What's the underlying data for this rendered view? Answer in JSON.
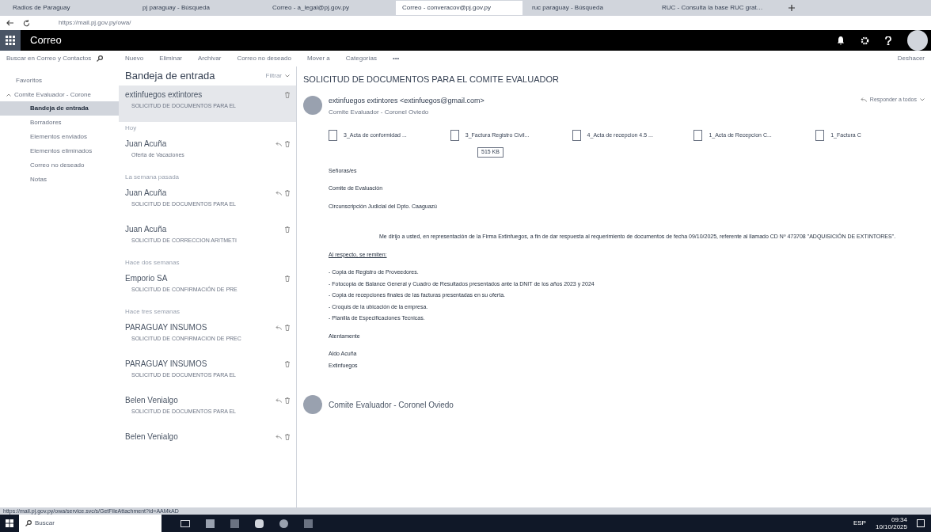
{
  "browser": {
    "tabs": [
      {
        "label": "Radios de Paraguay",
        "selected": false
      },
      {
        "label": "pj paraguay - Búsqueda",
        "selected": false
      },
      {
        "label": "Correo - a_legal@pj.gov.py",
        "selected": false
      },
      {
        "label": "Correo - converacov@pj.gov.py",
        "selected": true
      },
      {
        "label": "ruc paraguay - Búsqueda",
        "selected": false
      },
      {
        "label": "RUC - Consulta la base RUC grat…",
        "selected": false
      }
    ],
    "address": "https://mail.pj.gov.py/owa/"
  },
  "app": {
    "title": "Correo"
  },
  "toolbar": {
    "search_placeholder": "Buscar en Correo y Contactos",
    "actions": [
      "Nuevo",
      "Eliminar",
      "Archivar",
      "Correo no deseado",
      "Mover a",
      "Categorías",
      "•••"
    ],
    "undo": "Deshacer"
  },
  "folders": {
    "favorites": "Favoritos",
    "account": {
      "label": "Comite Evaluador - Corone",
      "expanded": true,
      "children": [
        {
          "label": "Bandeja de entrada",
          "selected": true
        },
        {
          "label": "Borradores",
          "selected": false
        },
        {
          "label": "Elementos enviados",
          "selected": false
        },
        {
          "label": "Elementos eliminados",
          "selected": false
        },
        {
          "label": "Correo no deseado",
          "selected": false
        },
        {
          "label": "Notas",
          "selected": false
        }
      ]
    }
  },
  "message_list": {
    "title": "Bandeja de entrada",
    "filter": "Filtrar",
    "items": [
      {
        "kind": "message",
        "sender": "extinfuegos extintores",
        "subject": "SOLICITUD DE DOCUMENTOS PARA EL",
        "selected": true,
        "replied": false
      },
      {
        "kind": "header",
        "label": "Hoy"
      },
      {
        "kind": "message",
        "sender": "Juan Acuña",
        "subject": "Oferta de Vacaciones",
        "selected": false,
        "replied": true
      },
      {
        "kind": "header",
        "label": "La semana pasada"
      },
      {
        "kind": "message",
        "sender": "Juan Acuña",
        "subject": "SOLICITUD DE DOCUMENTOS PARA EL",
        "selected": false,
        "replied": true
      },
      {
        "kind": "message",
        "sender": "Juan Acuña",
        "subject": "SOLICITUD DE CORRECCION ARITMETI",
        "selected": false,
        "replied": false
      },
      {
        "kind": "header",
        "label": "Hace dos semanas"
      },
      {
        "kind": "message",
        "sender": "Emporio SA",
        "subject": "SOLICITUD DE CONFIRMACIÓN DE PRE",
        "selected": false,
        "replied": false
      },
      {
        "kind": "header",
        "label": "Hace tres semanas"
      },
      {
        "kind": "message",
        "sender": "PARAGUAY INSUMOS",
        "subject": "SOLICITUD DE CONFIRMACION DE PREC",
        "selected": false,
        "replied": true
      },
      {
        "kind": "message",
        "sender": "PARAGUAY INSUMOS",
        "subject": "SOLICITUD DE DOCUMENTOS PARA EL",
        "selected": false,
        "replied": false
      },
      {
        "kind": "message",
        "sender": "Belen Venialgo",
        "subject": "SOLICITUD DE DOCUMENTOS PARA EL",
        "selected": false,
        "replied": true
      },
      {
        "kind": "message",
        "sender": "Belen Venialgo",
        "selected": false,
        "replied": true
      }
    ]
  },
  "reading_pane": {
    "subject": "SOLICITUD DE DOCUMENTOS PARA EL COMITE EVALUADOR",
    "sender": "extinfuegos extintores <extinfuegos@gmail.com>",
    "reply_all": "Responder a todos",
    "recipient": "Comite Evaluador - Coronel Oviedo",
    "attachments": [
      "3_Acta de conformidad ...",
      "3_Factura Registro Civil...",
      "4_Acta de recepcion 4.5 ...",
      "1_Acta de Recepcion C...",
      "1_Factura C"
    ],
    "total_size": "515 KB",
    "body": [
      {
        "kind": "line",
        "text": "Señoras/es"
      },
      {
        "kind": "line",
        "text": "Comite de Evaluación"
      },
      {
        "kind": "line",
        "text": "Circunscripción Judicial del Dpto. Caaguazú"
      },
      {
        "kind": "paragraph",
        "text": "Me dirijo a usted, en representación de la Firma Extinfuegos, a fin de dar respuesta al requerimiento de documentos de fecha 09/10/2025, referente al llamado CD Nº 473708 \"ADQUISICIÓN DE EXTINTORES\"."
      },
      {
        "kind": "underlined",
        "text": "Al respecto, se remiten:"
      },
      {
        "kind": "list",
        "items": [
          "- Copia de Registro de Proveedores.",
          "- Fotocopia de Balance General y Cuadro de Resultados presentados ante la DNIT de los años 2023 y 2024",
          "- Copia de recepciones finales de las facturas presentadas en su oferta.",
          "- Croquis de la ubicación de la empresa.",
          "- Planilla de Especificaciones Tecnicas."
        ]
      },
      {
        "kind": "line",
        "text": "Atentamente"
      },
      {
        "kind": "signature",
        "items": [
          "Aldo Acuña",
          "Extinfuegos"
        ]
      }
    ],
    "second_sender": "Comite Evaluador - Coronel Oviedo"
  },
  "status_url": "https://mail.pj.gov.py/owa/service.svc/s/GetFileAttachment?id=AAMkAD",
  "taskbar": {
    "search": "Buscar",
    "language": "ESP",
    "time": "09:34",
    "date": "10/10/2025"
  }
}
